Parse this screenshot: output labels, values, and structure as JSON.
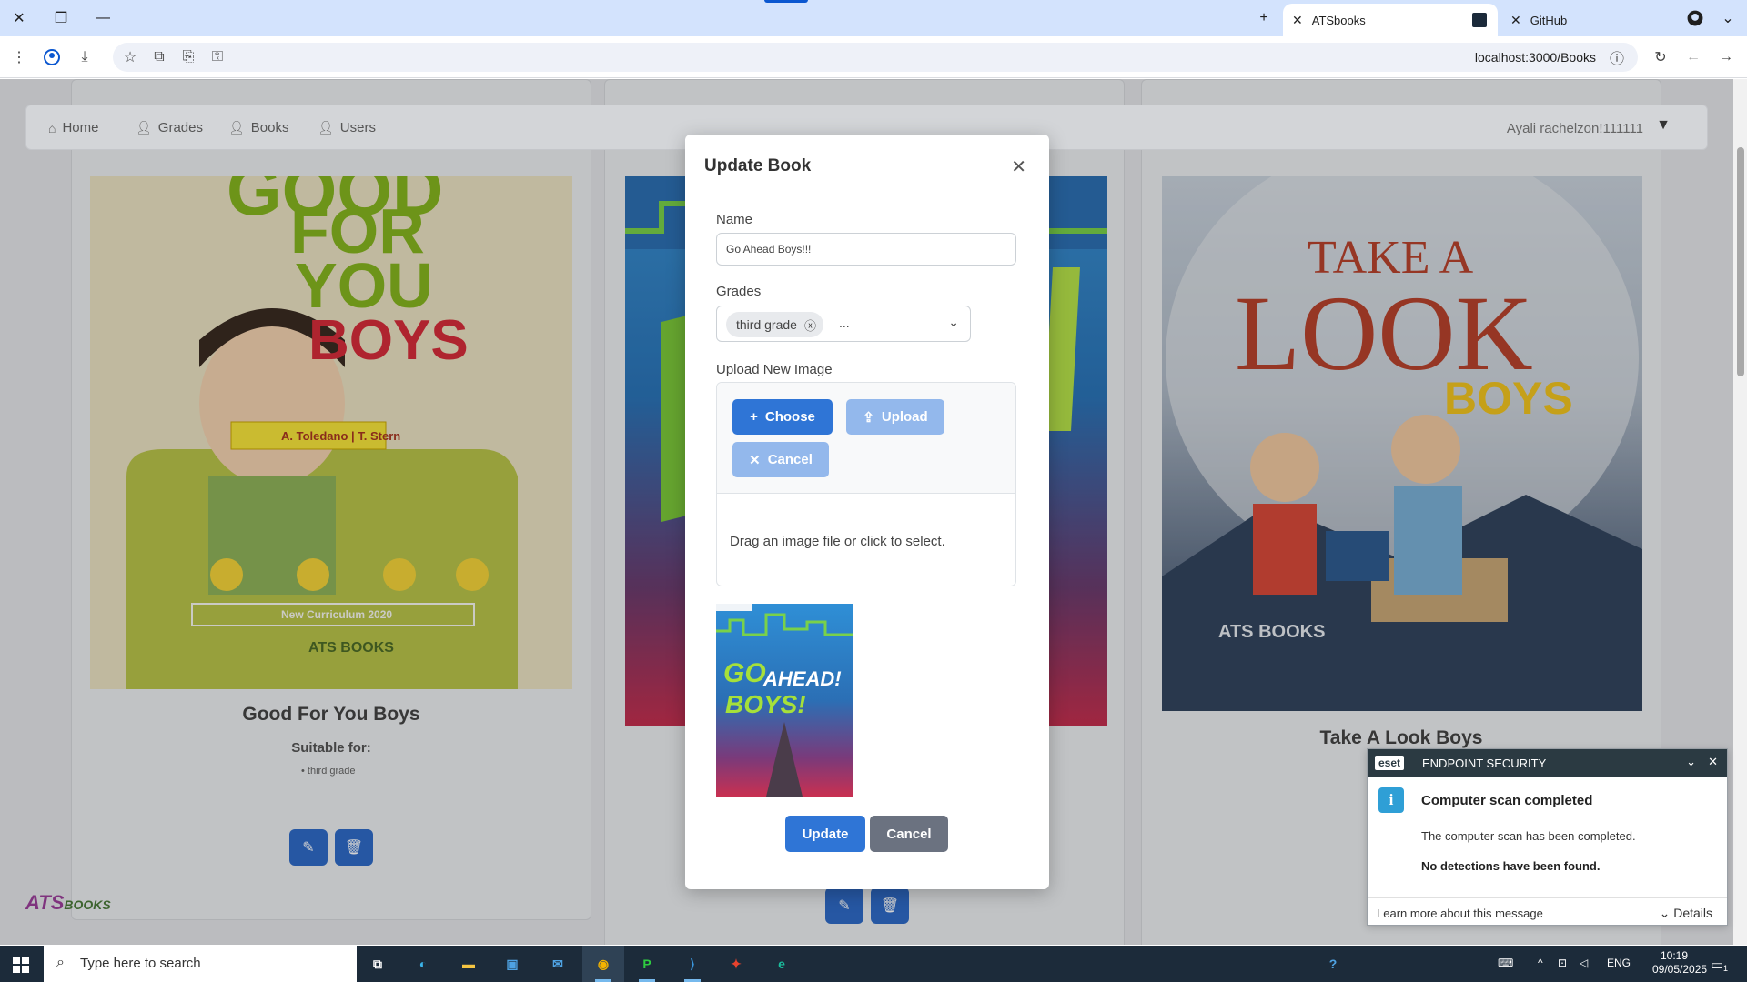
{
  "browser": {
    "tabs": [
      {
        "title": "ATSbooks",
        "active": true
      },
      {
        "title": "GitHub",
        "active": false
      }
    ],
    "url": "localhost:3000/Books",
    "icons": [
      "close-icon",
      "restore-icon",
      "minimize-icon",
      "new-tab-icon",
      "github-icon",
      "menu-icon",
      "profile-icon",
      "download-icon",
      "star-icon",
      "translate-icon",
      "cast-icon",
      "password-icon",
      "info-icon",
      "reload-icon",
      "back-icon",
      "forward-icon"
    ]
  },
  "navbar": {
    "items": [
      {
        "label": "Home",
        "icon": "home-icon"
      },
      {
        "label": "Grades",
        "icon": "user-icon"
      },
      {
        "label": "Books",
        "icon": "user-icon"
      },
      {
        "label": "Users",
        "icon": "user-icon"
      }
    ],
    "user": "Ayali rachelzon!111111"
  },
  "books": [
    {
      "title": "Good For You Boys",
      "suitable_label": "Suitable for:",
      "grades": [
        "third grade"
      ],
      "cover_text": [
        "GOOD",
        "FOR",
        "YOU",
        "BOYS",
        "A. Toledano | T. Stern",
        "New Curriculum 2020",
        "ATS BOOKS"
      ]
    },
    {
      "title": "Go Ahead Boys!!!"
    },
    {
      "title": "Take A Look Boys",
      "cover_text": [
        "TAKE A",
        "LOOK",
        "BOYS",
        "ATS BOOKS"
      ]
    }
  ],
  "modal": {
    "title": "Update Book",
    "name_label": "Name",
    "name_value": "Go Ahead Boys!!!",
    "grades_label": "Grades",
    "grades_selected": [
      "third grade"
    ],
    "grades_more": "...",
    "upload_label": "Upload New Image",
    "choose_label": "Choose",
    "upload_button_label": "Upload",
    "cancel_upload_label": "Cancel",
    "drop_text": "Drag an image file or click to select.",
    "preview_text": [
      "GO",
      "AHEAD!",
      "BOYS!"
    ],
    "update_label": "Update",
    "cancel_label": "Cancel"
  },
  "eset": {
    "brand": "ENDPOINT SECURITY",
    "logo": "eset",
    "title": "Computer scan completed",
    "body": "The computer scan has been completed.",
    "body_bold": "No detections have been found.",
    "learn": "Learn more about this message",
    "details": "Details"
  },
  "taskbar": {
    "search_placeholder": "Type here to search",
    "lang": "ENG",
    "time": "10:19",
    "date": "09/05/2025",
    "notification_count": "1"
  },
  "colors": {
    "primary": "#2f75d6",
    "primary_disabled": "#93b8ec",
    "secondary": "#6b7280",
    "taskbar": "#1c2b3a"
  }
}
